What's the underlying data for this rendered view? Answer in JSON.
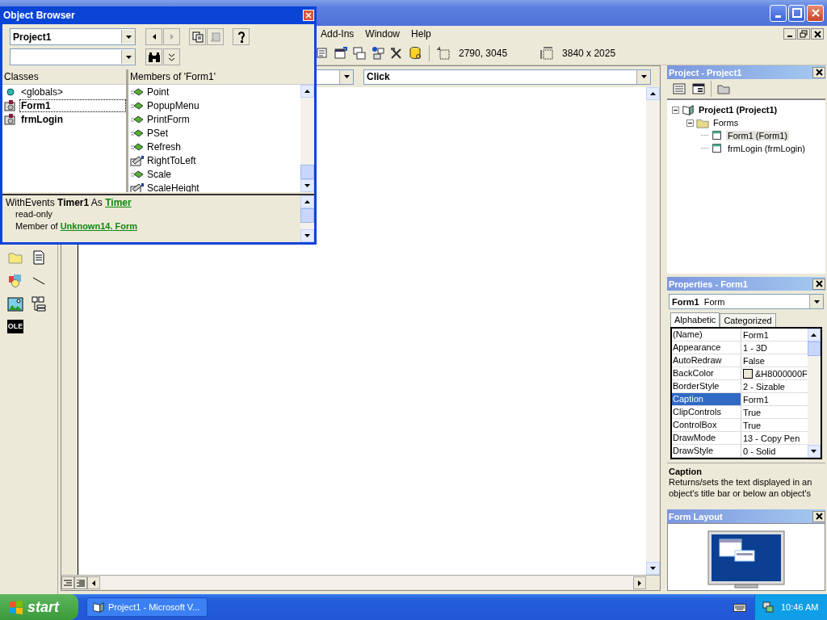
{
  "menu": [
    {
      "label": "Add-Ins"
    },
    {
      "label": "Window"
    },
    {
      "label": "Help"
    }
  ],
  "toolbar": {
    "position": "2790, 3045",
    "size": "3840 x 2025"
  },
  "code_window": {
    "procedure": "Click"
  },
  "toolbox": {
    "ole_label": "OLE"
  },
  "object_browser": {
    "title": "Object Browser",
    "library": "Project1",
    "classes_header": "Classes",
    "classes": [
      {
        "label": "<globals>",
        "kind": "globals",
        "selected": false
      },
      {
        "label": "Form1",
        "kind": "form",
        "selected": true
      },
      {
        "label": "frmLogin",
        "kind": "form",
        "selected": false
      }
    ],
    "members_header": "Members of 'Form1'",
    "members": [
      {
        "label": "Point",
        "kind": "method"
      },
      {
        "label": "PopupMenu",
        "kind": "method"
      },
      {
        "label": "PrintForm",
        "kind": "method"
      },
      {
        "label": "PSet",
        "kind": "method"
      },
      {
        "label": "Refresh",
        "kind": "method"
      },
      {
        "label": "RightToLeft",
        "kind": "property"
      },
      {
        "label": "Scale",
        "kind": "method"
      },
      {
        "label": "ScaleHeight",
        "kind": "property"
      }
    ],
    "details": {
      "declaration": "WithEvents **Timer1** As",
      "type_link": "Timer",
      "access": "read-only",
      "member_prefix": "Member of",
      "member_links": [
        "Unknown14",
        "Form"
      ],
      "member_separator": "."
    }
  },
  "project": {
    "title": "Project - Project1",
    "tree": [
      {
        "label": "Project1 (Project1)",
        "kind": "project",
        "expanded": true,
        "selected": false,
        "children": [
          {
            "label": "Forms",
            "kind": "folder",
            "expanded": true,
            "selected": false,
            "children": [
              {
                "label": "Form1 (Form1)",
                "kind": "form",
                "selected": true
              },
              {
                "label": "frmLogin (frmLogin)",
                "kind": "form",
                "selected": false
              }
            ]
          }
        ]
      }
    ]
  },
  "properties": {
    "title": "Properties - Form1",
    "object_name": "Form1",
    "object_type": "Form",
    "tabs": [
      {
        "label": "Alphabetic",
        "selected": true
      },
      {
        "label": "Categorized",
        "selected": false
      }
    ],
    "rows": [
      {
        "name": "(Name)",
        "value": "Form1",
        "selected": false
      },
      {
        "name": "Appearance",
        "value": "1 - 3D",
        "selected": false
      },
      {
        "name": "AutoRedraw",
        "value": "False",
        "selected": false
      },
      {
        "name": "BackColor",
        "value": "&H8000000F",
        "selected": false,
        "kind": "color",
        "color": "#ece9d8"
      },
      {
        "name": "BorderStyle",
        "value": "2 - Sizable",
        "selected": false
      },
      {
        "name": "Caption",
        "value": "Form1",
        "selected": true
      },
      {
        "name": "ClipControls",
        "value": "True",
        "selected": false
      },
      {
        "name": "ControlBox",
        "value": "True",
        "selected": false
      },
      {
        "name": "DrawMode",
        "value": "13 - Copy Pen",
        "selected": false
      },
      {
        "name": "DrawStyle",
        "value": "0 - Solid",
        "selected": false
      }
    ],
    "description_title": "Caption",
    "description": "Returns/sets the text displayed in an object's title bar or below an object's"
  },
  "form_layout": {
    "title": "Form Layout"
  },
  "taskbar": {
    "start": "start",
    "task": "Project1 - Microsoft V...",
    "clock": "10:46 AM"
  }
}
